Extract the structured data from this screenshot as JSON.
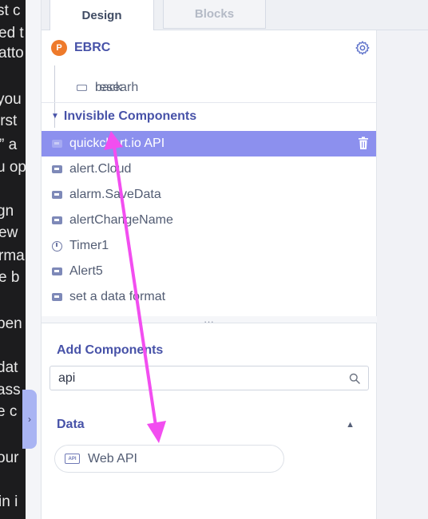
{
  "backdrop_lines": [
    "st c",
    "ed t",
    "atto",
    "you",
    "irst",
    "” a",
    "u op",
    "gn",
    "ew",
    "rma",
    "e b",
    "pen",
    "dat",
    "ass",
    "e c",
    "our",
    "in i"
  ],
  "tabs": {
    "design": "Design",
    "blocks": "Blocks"
  },
  "tree": {
    "root": {
      "logo_letter": "P",
      "name": "EBRC"
    },
    "components": [
      "back",
      "researh"
    ],
    "invisible_header": "Invisible Components",
    "invisible_items": [
      {
        "label": "quickchart.io API",
        "icon": "nonvisible-component-icon",
        "selected": true
      },
      {
        "label": "alert.Cloud",
        "icon": "nonvisible-component-icon"
      },
      {
        "label": "alarm.SaveData",
        "icon": "nonvisible-component-icon"
      },
      {
        "label": "alertChangeName",
        "icon": "nonvisible-component-icon"
      },
      {
        "label": "Timer1",
        "icon": "timer-icon"
      },
      {
        "label": "Alert5",
        "icon": "nonvisible-component-icon"
      },
      {
        "label": "set a data format",
        "icon": "nonvisible-component-icon"
      }
    ]
  },
  "splitter": "...",
  "add_components": {
    "title": "Add Components",
    "search_value": "api",
    "category": "Data",
    "results": [
      {
        "label": "Web API",
        "badge": "API"
      }
    ]
  },
  "colors": {
    "accent": "#4752a8",
    "selected_row": "#8c90ee",
    "annotation_arrow": "#f24ef0",
    "logo": "#ee7a2b"
  }
}
